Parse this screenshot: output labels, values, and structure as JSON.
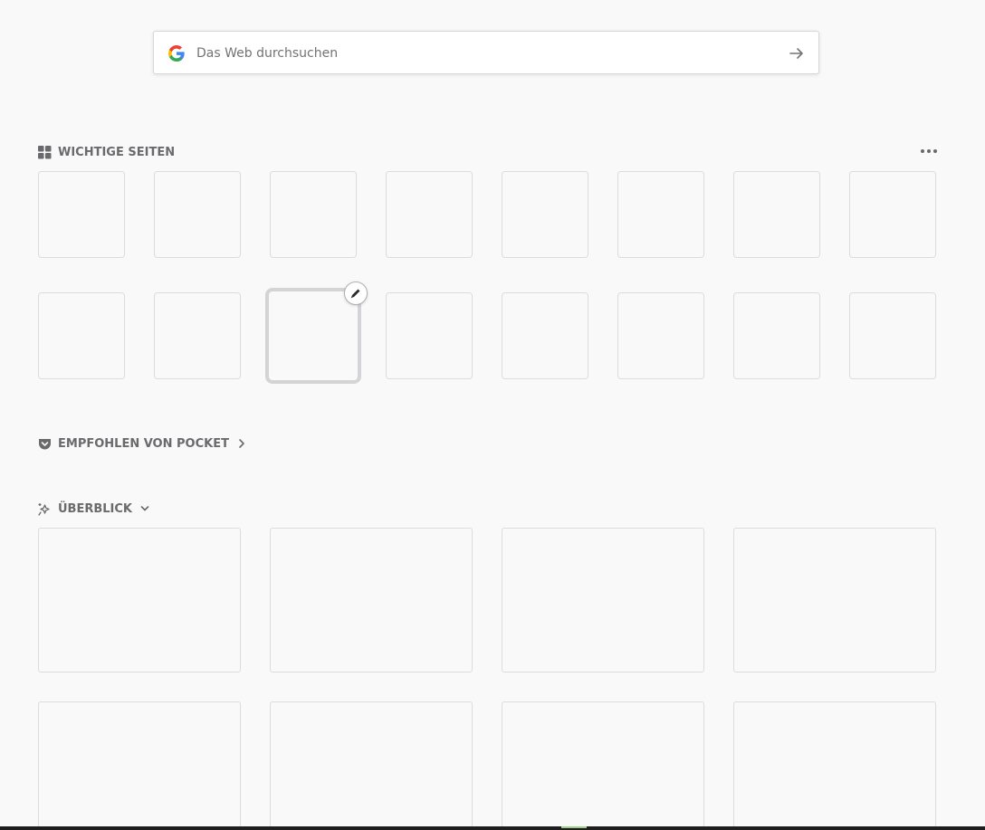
{
  "search": {
    "placeholder": "Das Web durchsuchen",
    "engine_icon": "google-g-icon",
    "submit_icon": "arrow-right-icon"
  },
  "top_sites": {
    "title": "WICHTIGE SEITEN",
    "icon": "grid-icon",
    "menu_icon": "more-horizontal-icon",
    "tile_count": 16,
    "edit_icon": "pencil-icon"
  },
  "pocket": {
    "title": "EMPFOHLEN VON POCKET",
    "icon": "pocket-icon",
    "chevron": "chevron-right-icon"
  },
  "highlights": {
    "title": "ÜBERBLICK",
    "icon": "sparkle-icon",
    "chevron": "chevron-down-icon",
    "card_count": 8
  },
  "colors": {
    "background": "#f9f9fa",
    "tile_border": "#dcdcde",
    "heading_text": "#6a6a6d"
  }
}
